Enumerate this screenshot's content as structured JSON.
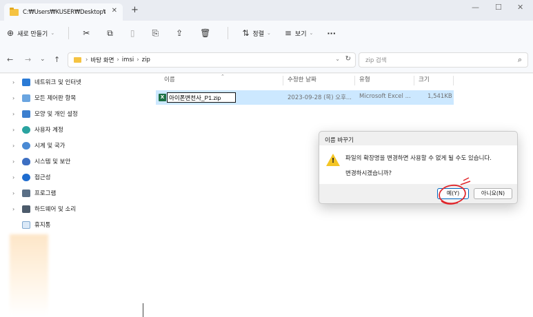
{
  "window": {
    "tab_title": "C:₩Users₩KUSER₩Desktop₩i",
    "tab_close": "✕",
    "new_tab": "+",
    "minimize": "—",
    "maximize": "☐",
    "close": "✕"
  },
  "toolbar": {
    "new_label": "새로 만들기",
    "sort_label": "정렬",
    "view_label": "보기",
    "more_label": "···"
  },
  "nav": {
    "back": "←",
    "forward": "→",
    "recent": "⌄",
    "up": "↑"
  },
  "address": {
    "crumbs": [
      "바탕 화면",
      "imsi",
      "zip"
    ],
    "sep": "›",
    "first_sep": "›"
  },
  "search": {
    "placeholder": "zip 검색",
    "icon": "⌕"
  },
  "sidebar": {
    "items": [
      {
        "label": "네트워크 및 인터넷",
        "icon": "network-icon",
        "color": "#2b7bd6"
      },
      {
        "label": "모든 제어판 항목",
        "icon": "control-panel-icon",
        "color": "#6aa5e0"
      },
      {
        "label": "모양 및 개인 설정",
        "icon": "appearance-icon",
        "color": "#3c7fcf"
      },
      {
        "label": "사용자 계정",
        "icon": "user-accounts-icon",
        "color": "#2aa3a0"
      },
      {
        "label": "시계 및 국가",
        "icon": "clock-globe-icon",
        "color": "#4a8ad4"
      },
      {
        "label": "시스템 및 보안",
        "icon": "shield-icon",
        "color": "#3d6fc2"
      },
      {
        "label": "접근성",
        "icon": "accessibility-icon",
        "color": "#1e6ccf"
      },
      {
        "label": "프로그램",
        "icon": "programs-icon",
        "color": "#5a6f86"
      },
      {
        "label": "하드웨어 및 소리",
        "icon": "hardware-icon",
        "color": "#4c5b6b"
      },
      {
        "label": "휴지통",
        "icon": "recycle-bin-icon",
        "color": "#7fa8cf"
      }
    ],
    "chevron": "›"
  },
  "columns": {
    "name": "이름",
    "modified": "수정한 날짜",
    "type": "유형",
    "size": "크기"
  },
  "file": {
    "icon_letter": "X",
    "name_edit_value": "아이폰변천사_P1.zip",
    "modified": "2023-09-28 (목) 오후...",
    "type": "Microsoft Excel ...",
    "size": "1,541KB"
  },
  "dialog": {
    "title": "이름 바꾸기",
    "message_line1": "파일의 확장명을 변경하면 사용할 수 없게 될 수도 있습니다.",
    "message_line2": "변경하시겠습니까?",
    "yes": "예(Y)",
    "no": "아니요(N)",
    "warning_mark": "!"
  },
  "colors": {
    "selection": "#cce8ff",
    "accent": "#0067c0",
    "annotation": "#e0262b",
    "warning": "#f4c524"
  }
}
